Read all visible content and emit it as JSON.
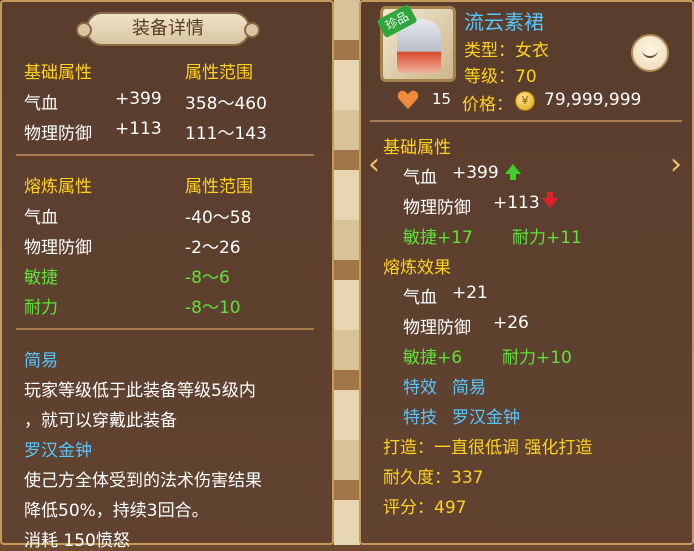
{
  "left_panel": {
    "title": "装备详情",
    "base_section": {
      "header": "基础属性",
      "range_header": "属性范围",
      "rows": [
        {
          "name": "气血",
          "value": "+399",
          "range": "358～460"
        },
        {
          "name": "物理防御",
          "value": "+113",
          "range": "111～143"
        }
      ]
    },
    "refine_section": {
      "header": "熔炼属性",
      "range_header": "属性范围",
      "rows": [
        {
          "name": "气血",
          "range": "-40～58"
        },
        {
          "name": "物理防御",
          "range": "-2～26"
        },
        {
          "name": "敏捷",
          "range": "-8～6"
        },
        {
          "name": "耐力",
          "range": "-8～10"
        }
      ]
    },
    "effect_title": "简易",
    "effect_desc_line1": "玩家等级低于此装备等级5级内",
    "effect_desc_line2": "，就可以穿戴此装备",
    "skill_title": "罗汉金钟",
    "skill_desc_line1": "使己方全体受到的法术伤害结果",
    "skill_desc_line2": "降低50%，持续3回合。",
    "skill_cost": "消耗 150愤怒"
  },
  "right_panel": {
    "badge": "珍品",
    "item_name": "流云素裙",
    "type": "类型：女衣",
    "level": "等级：70",
    "likes": "15",
    "price_label": "价格：",
    "price_value": "79,999,999",
    "base_header": "基础属性",
    "base_rows": [
      {
        "name": "气血",
        "value": "+399"
      },
      {
        "name": "物理防御",
        "value": "+113"
      }
    ],
    "base_bonus_a": "敏捷+17",
    "base_bonus_b": "耐力+11",
    "refine_header": "熔炼效果",
    "refine_rows": [
      {
        "name": "气血",
        "value": "+21"
      },
      {
        "name": "物理防御",
        "value": "+26"
      }
    ],
    "refine_bonus_a": "敏捷+6",
    "refine_bonus_b": "耐力+10",
    "effect_label": "特效",
    "effect_value": "简易",
    "skill_label": "特技",
    "skill_value": "罗汉金钟",
    "forge": "打造：一直很低调  强化打造",
    "durability": "耐久度：337",
    "score": "评分：497"
  },
  "colors": {
    "yellow": "#ffd21e",
    "green": "#5fe13a",
    "blue": "#57c6ff",
    "panel": "#5c3f2d"
  },
  "icons": {
    "eye": "eye-closed-icon",
    "heart": "heart-icon",
    "coin": "coin-icon",
    "left_arrow": "chevron-left-icon",
    "right_arrow": "chevron-right-icon",
    "up": "arrow-up-icon",
    "down": "arrow-down-icon"
  }
}
